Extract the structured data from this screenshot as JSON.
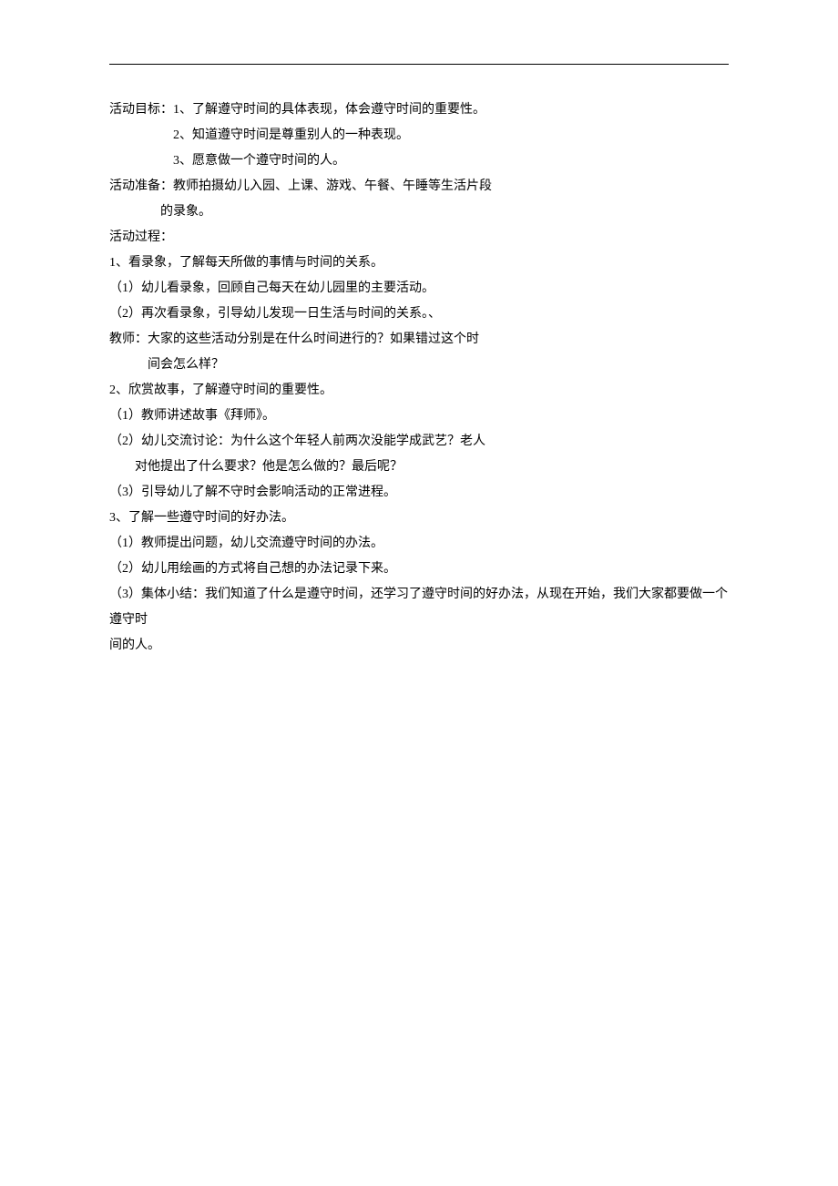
{
  "lines": {
    "l1": "活动目标：1、了解遵守时间的具体表现，体会遵守时间的重要性。",
    "l2": "2、知道遵守时间是尊重别人的一种表现。",
    "l3": "3、愿意做一个遵守时间的人。",
    "l4": "活动准备：教师拍摄幼儿入园、上课、游戏、午餐、午睡等生活片段",
    "l5": "的录象。",
    "l6": "活动过程：",
    "l7": "1、看录象，了解每天所做的事情与时间的关系。",
    "l8": "（1）幼儿看录象，回顾自己每天在幼儿园里的主要活动。",
    "l9": "（2）再次看录象，引导幼儿发现一日生活与时间的关系。、",
    "l10": " 教师：大家的这些活动分别是在什么时间进行的？如果错过这个时",
    "l11": "间会怎么样？",
    "l12": "2、欣赏故事，了解遵守时间的重要性。",
    "l13": "（1）教师讲述故事《拜师》。",
    "l14": "（2）幼儿交流讨论：为什么这个年轻人前两次没能学成武艺？老人",
    "l15": "对他提出了什么要求？他是怎么做的？最后呢？",
    "l16": "（3）引导幼儿了解不守时会影响活动的正常进程。",
    "l17": "3、了解一些遵守时间的好办法。",
    "l18": "（1）教师提出问题，幼儿交流遵守时间的办法。",
    "l19": "（2）幼儿用绘画的方式将自己想的办法记录下来。",
    "l20": "（3）集体小结：我们知道了什么是遵守时间，还学习了遵守时间的好办法，从现在开始，我们大家都要做一个遵守时",
    "l21": "间的人。"
  }
}
